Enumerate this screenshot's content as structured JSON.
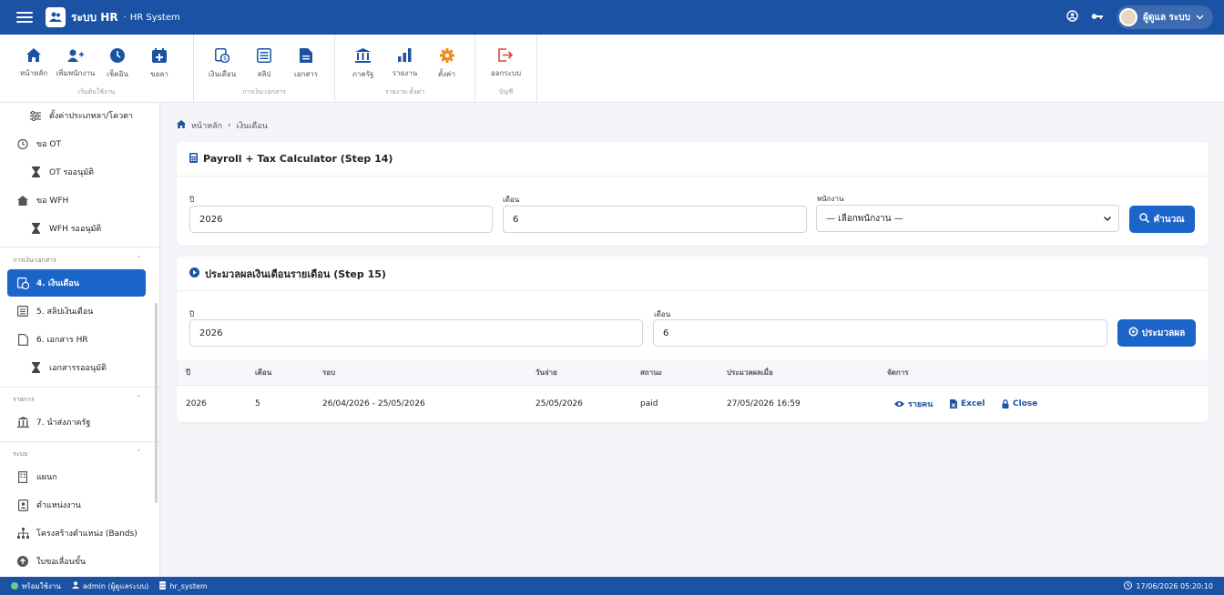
{
  "topbar": {
    "title": "ระบบ HR",
    "separator": "·",
    "subtitle": "HR System",
    "user_name": "ผู้ดูแล ระบบ"
  },
  "ribbon": {
    "groups": [
      {
        "label": "เริ่มต้นใช้งาน",
        "items": [
          {
            "label": "หน้าหลัก",
            "icon": "home-icon"
          },
          {
            "label": "เพิ่มพนักงาน",
            "icon": "add-user-icon"
          },
          {
            "label": "เช็คอิน",
            "icon": "clock-icon"
          },
          {
            "label": "ขอลา",
            "icon": "calendar-plus-icon"
          }
        ]
      },
      {
        "label": "การเงิน-เอกสาร",
        "items": [
          {
            "label": "เงินเดือน",
            "icon": "payroll-icon"
          },
          {
            "label": "สลิป",
            "icon": "slip-icon"
          },
          {
            "label": "เอกสาร",
            "icon": "document-icon"
          }
        ]
      },
      {
        "label": "รายงาน-ตั้งค่า",
        "items": [
          {
            "label": "ภาครัฐ",
            "icon": "government-icon"
          },
          {
            "label": "รายงาน",
            "icon": "report-icon"
          },
          {
            "label": "ตั้งค่า",
            "icon": "gear-icon"
          }
        ]
      },
      {
        "label": "บัญชี",
        "items": [
          {
            "label": "ออกระบบ",
            "icon": "logout-icon"
          }
        ]
      }
    ]
  },
  "sidebar": {
    "items": [
      {
        "label": "ตั้งค่าประเภทลา/โควตา",
        "icon": "sliders-icon"
      },
      {
        "label": "ขอ OT",
        "icon": "stopwatch-icon"
      },
      {
        "label": "OT รออนุมัติ",
        "icon": "hourglass-icon"
      },
      {
        "label": "ขอ WFH",
        "icon": "house-icon"
      },
      {
        "label": "WFH รออนุมัติ",
        "icon": "hourglass-icon"
      },
      {
        "label": "4. เงินเดือน",
        "icon": "payroll-icon"
      },
      {
        "label": "5. สลิปเงินเดือน",
        "icon": "slip-icon"
      },
      {
        "label": "6. เอกสาร HR",
        "icon": "document-icon"
      },
      {
        "label": "เอกสารรออนุมัติ",
        "icon": "hourglass-icon"
      },
      {
        "label": "7. นำส่งภาครัฐ",
        "icon": "government-icon"
      },
      {
        "label": "แผนก",
        "icon": "building-icon"
      },
      {
        "label": "ตำแหน่งงาน",
        "icon": "badge-icon"
      },
      {
        "label": "โครงสร้างตำแหน่ง (Bands)",
        "icon": "sitemap-icon"
      },
      {
        "label": "ใบขอเลื่อนขั้น",
        "icon": "arrow-up-circle-icon"
      }
    ],
    "sections": [
      {
        "label": "การเงิน-เอกสาร",
        "chevron": "˅"
      },
      {
        "label": "รายการ",
        "chevron": "˅"
      },
      {
        "label": "ระบบ",
        "chevron": "˅"
      }
    ]
  },
  "breadcrumb": {
    "home": "หน้าหลัก",
    "separator": "›",
    "current": "เงินเดือน"
  },
  "calc_card": {
    "title": "Payroll + Tax Calculator (Step 14)",
    "year_label": "ปี",
    "year_value": "2026",
    "month_label": "เดือน",
    "month_value": "6",
    "employee_label": "พนักงาน",
    "employee_value": "— เลือกพนักงาน —",
    "button_label": "คำนวณ"
  },
  "process_card": {
    "title": "ประมวลผลเงินเดือนรายเดือน (Step 15)",
    "year_label": "ปี",
    "year_value": "2026",
    "month_label": "เดือน",
    "month_value": "6",
    "button_label": "ประมวลผล",
    "columns": [
      "ปี",
      "เดือน",
      "รอบ",
      "วันจ่าย",
      "สถานะ",
      "ประมวลผลเมื่อ",
      "จัดการ"
    ],
    "rows": [
      {
        "year": "2026",
        "month": "5",
        "period": "26/04/2026 - 25/05/2026",
        "pay_date": "25/05/2026",
        "status": "paid",
        "processed_at": "27/05/2026 16:59",
        "actions": {
          "detail": "รายคน",
          "excel": "Excel",
          "close": "Close"
        }
      }
    ]
  },
  "statusbar": {
    "ready": "พร้อมใช้งาน",
    "user": "admin (ผู้ดูแลระบบ)",
    "db": "hr_system",
    "datetime": "17/06/2026 05:20:10"
  },
  "colors": {
    "primary": "#1b52a4",
    "accent": "#1b64c8",
    "logout": "#e0413a",
    "gear": "#f08a1c"
  }
}
